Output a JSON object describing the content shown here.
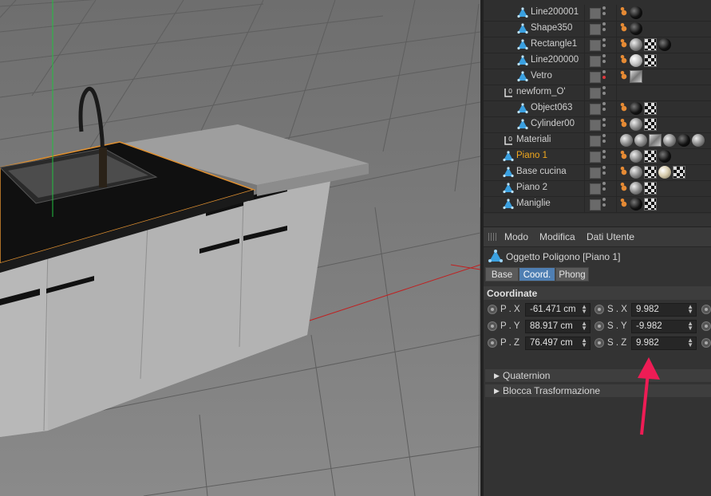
{
  "object_manager": {
    "rows": [
      {
        "name": "Line200001",
        "depth": 2,
        "selected": false,
        "tags": [
          "phong",
          "ball-dark"
        ],
        "dot": "grey"
      },
      {
        "name": "Shape350",
        "depth": 2,
        "selected": false,
        "tags": [
          "phong",
          "ball-dark"
        ],
        "dot": "grey"
      },
      {
        "name": "Rectangle1",
        "depth": 2,
        "selected": false,
        "tags": [
          "phong",
          "ball-grey",
          "checker",
          "ball-dark"
        ],
        "dot": "grey"
      },
      {
        "name": "Line200000",
        "depth": 2,
        "selected": false,
        "tags": [
          "phong",
          "ball-light",
          "checker"
        ],
        "dot": "grey"
      },
      {
        "name": "Vetro",
        "depth": 2,
        "selected": false,
        "tags": [
          "phong",
          "glass"
        ],
        "dot": "red"
      },
      {
        "name": "newform_O'",
        "depth": 1,
        "selected": false,
        "tags": [],
        "dot": "grey",
        "group": true
      },
      {
        "name": "Object063",
        "depth": 2,
        "selected": false,
        "tags": [
          "phong",
          "ball-dark",
          "checker"
        ],
        "dot": "grey"
      },
      {
        "name": "Cylinder00",
        "depth": 2,
        "selected": false,
        "tags": [
          "phong",
          "ball-grey",
          "checker"
        ],
        "dot": "grey"
      },
      {
        "name": "Materiali",
        "depth": 1,
        "selected": false,
        "tags": [
          "ball-grey",
          "ball-grey",
          "glass",
          "ball-grey",
          "ball-dark",
          "ball-grey"
        ],
        "dot": "grey",
        "group": true
      },
      {
        "name": "Piano 1",
        "depth": 1,
        "selected": true,
        "tags": [
          "phong",
          "ball-grey",
          "checker",
          "ball-dark"
        ],
        "dot": "grey"
      },
      {
        "name": "Base cucina",
        "depth": 1,
        "selected": false,
        "tags": [
          "phong",
          "ball-grey",
          "checker",
          "ball-cream",
          "checker"
        ],
        "dot": "grey"
      },
      {
        "name": "Piano 2",
        "depth": 1,
        "selected": false,
        "tags": [
          "phong",
          "ball-grey",
          "checker"
        ],
        "dot": "grey"
      },
      {
        "name": "Maniglie",
        "depth": 1,
        "selected": false,
        "tags": [
          "phong",
          "ball-dark",
          "checker"
        ],
        "dot": "grey"
      }
    ]
  },
  "attribute_manager": {
    "menu": [
      "Modo",
      "Modifica",
      "Dati Utente"
    ],
    "object_title": "Oggetto Poligono [Piano 1]",
    "tabs": [
      {
        "label": "Base",
        "active": false
      },
      {
        "label": "Coord.",
        "active": true
      },
      {
        "label": "Phong",
        "active": false
      }
    ],
    "section": "Coordinate",
    "fields": [
      {
        "pos_label": "P . X",
        "pos_value": "-61.471 cm",
        "scale_label": "S . X",
        "scale_value": "9.982"
      },
      {
        "pos_label": "P . Y",
        "pos_value": "88.917 cm",
        "scale_label": "S . Y",
        "scale_value": "-9.982"
      },
      {
        "pos_label": "P . Z",
        "pos_value": "76.497 cm",
        "scale_label": "S . Z",
        "scale_value": "9.982"
      }
    ],
    "collapsed_groups": [
      "Quaternion",
      "Blocca Trasformazione"
    ]
  },
  "colors": {
    "selected_text": "#f2a81d",
    "active_tab": "#4f7fb3",
    "annotation_arrow": "#ee1c55"
  }
}
